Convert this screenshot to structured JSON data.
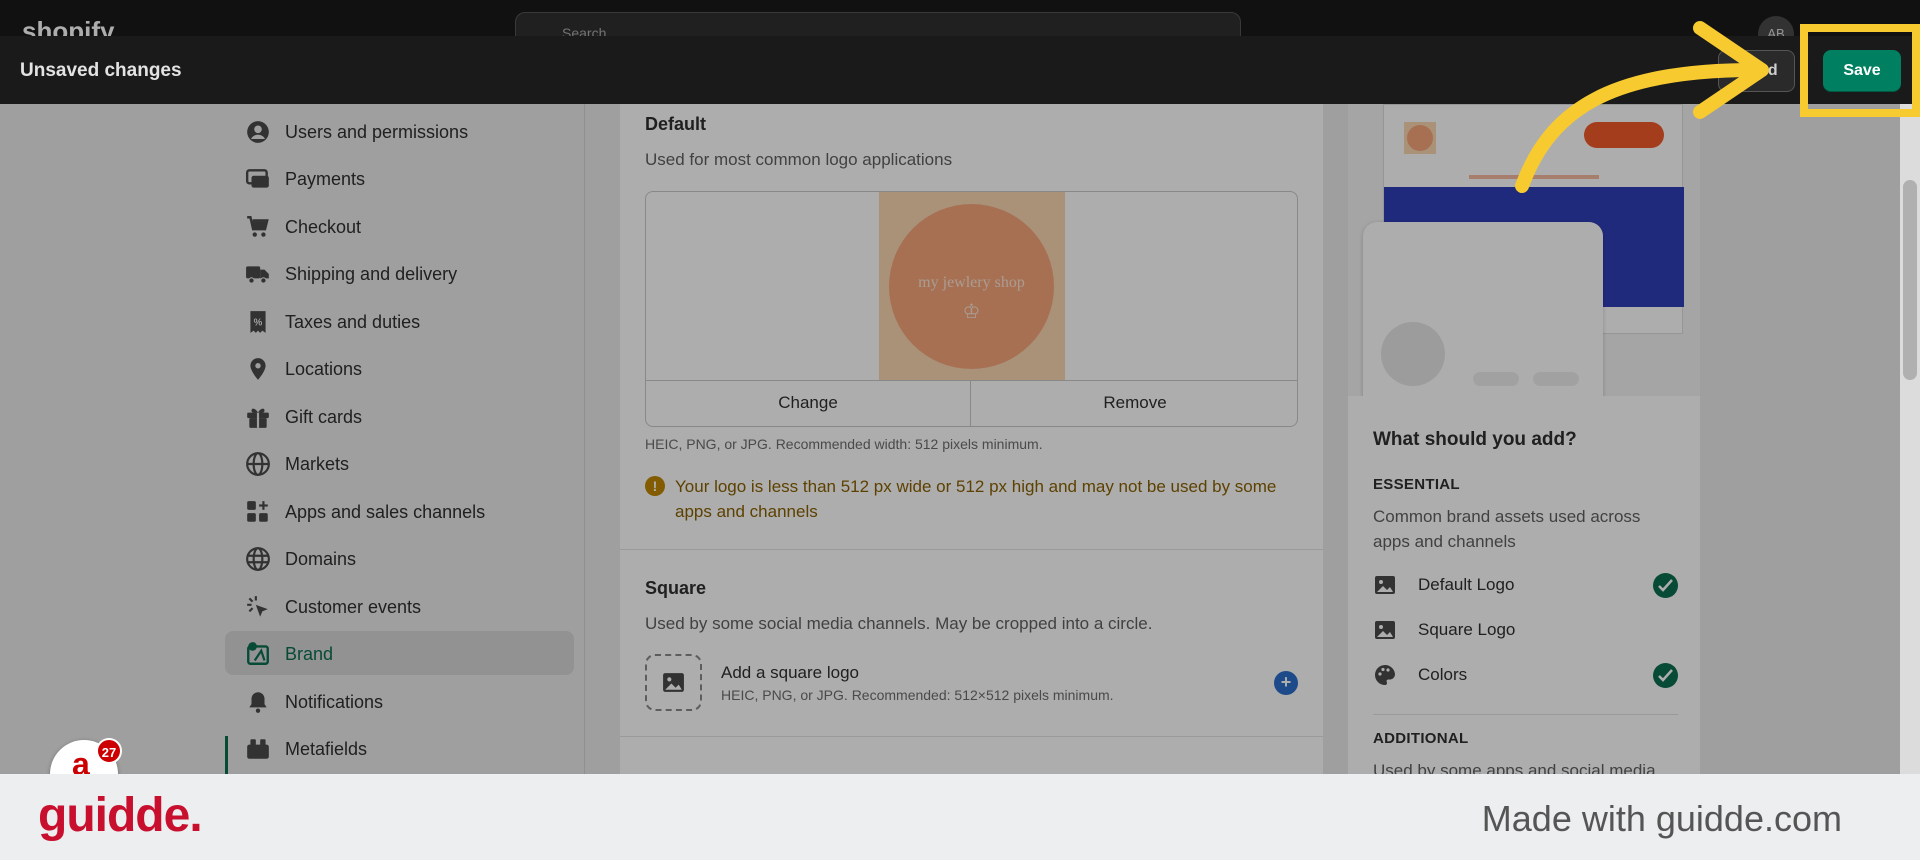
{
  "app": {
    "logo_text": "shopify",
    "search_placeholder": "Search",
    "avatar_initials": "AB"
  },
  "unsaved_bar": {
    "title": "Unsaved changes",
    "discard_label": "scard",
    "save_label": "Save"
  },
  "sidebar": {
    "items": [
      {
        "label": "Users and permissions",
        "icon": "user-circle-icon"
      },
      {
        "label": "Payments",
        "icon": "payments-icon"
      },
      {
        "label": "Checkout",
        "icon": "cart-icon"
      },
      {
        "label": "Shipping and delivery",
        "icon": "truck-icon"
      },
      {
        "label": "Taxes and duties",
        "icon": "receipt-icon"
      },
      {
        "label": "Locations",
        "icon": "location-pin-icon"
      },
      {
        "label": "Gift cards",
        "icon": "gift-icon"
      },
      {
        "label": "Markets",
        "icon": "globe-icon"
      },
      {
        "label": "Apps and sales channels",
        "icon": "apps-icon"
      },
      {
        "label": "Domains",
        "icon": "globe-icon"
      },
      {
        "label": "Customer events",
        "icon": "cursor-click-icon"
      },
      {
        "label": "Brand",
        "icon": "brand-icon",
        "active": true
      },
      {
        "label": "Notifications",
        "icon": "bell-icon"
      },
      {
        "label": "Metafields",
        "icon": "metafields-icon"
      }
    ]
  },
  "default_logo": {
    "title": "Default",
    "subtitle": "Used for most common logo applications",
    "logo_text": "my jewlery shop",
    "logo_glyph": "♔",
    "change_label": "Change",
    "remove_label": "Remove",
    "hint": "HEIC, PNG, or JPG. Recommended width: 512 pixels minimum.",
    "warning": "Your logo is less than 512 px wide or 512 px high and may not be used by some apps and channels"
  },
  "square_logo": {
    "title": "Square",
    "subtitle": "Used by some social media channels. May be cropped into a circle.",
    "add_title": "Add a square logo",
    "add_hint": "HEIC, PNG, or JPG. Recommended: 512×512 pixels minimum."
  },
  "right_panel": {
    "heading": "What should you add?",
    "essential_caption": "ESSENTIAL",
    "essential_sub": "Common brand assets used across apps and channels",
    "assets": [
      {
        "label": "Default Logo",
        "icon": "image-icon",
        "done": true
      },
      {
        "label": "Square Logo",
        "icon": "image-icon",
        "done": false
      },
      {
        "label": "Colors",
        "icon": "palette-icon",
        "done": true
      }
    ],
    "additional_caption": "ADDITIONAL",
    "additional_sub": "Used by some apps and social media"
  },
  "chat": {
    "badge_count": "27"
  },
  "footer": {
    "brand": "guidde.",
    "made_with": "Made with guidde.com"
  },
  "colors": {
    "accent_green": "#0b6e4f",
    "save_green": "#008060",
    "highlight_yellow": "#f7ca30",
    "guidde_red": "#c8102e"
  }
}
